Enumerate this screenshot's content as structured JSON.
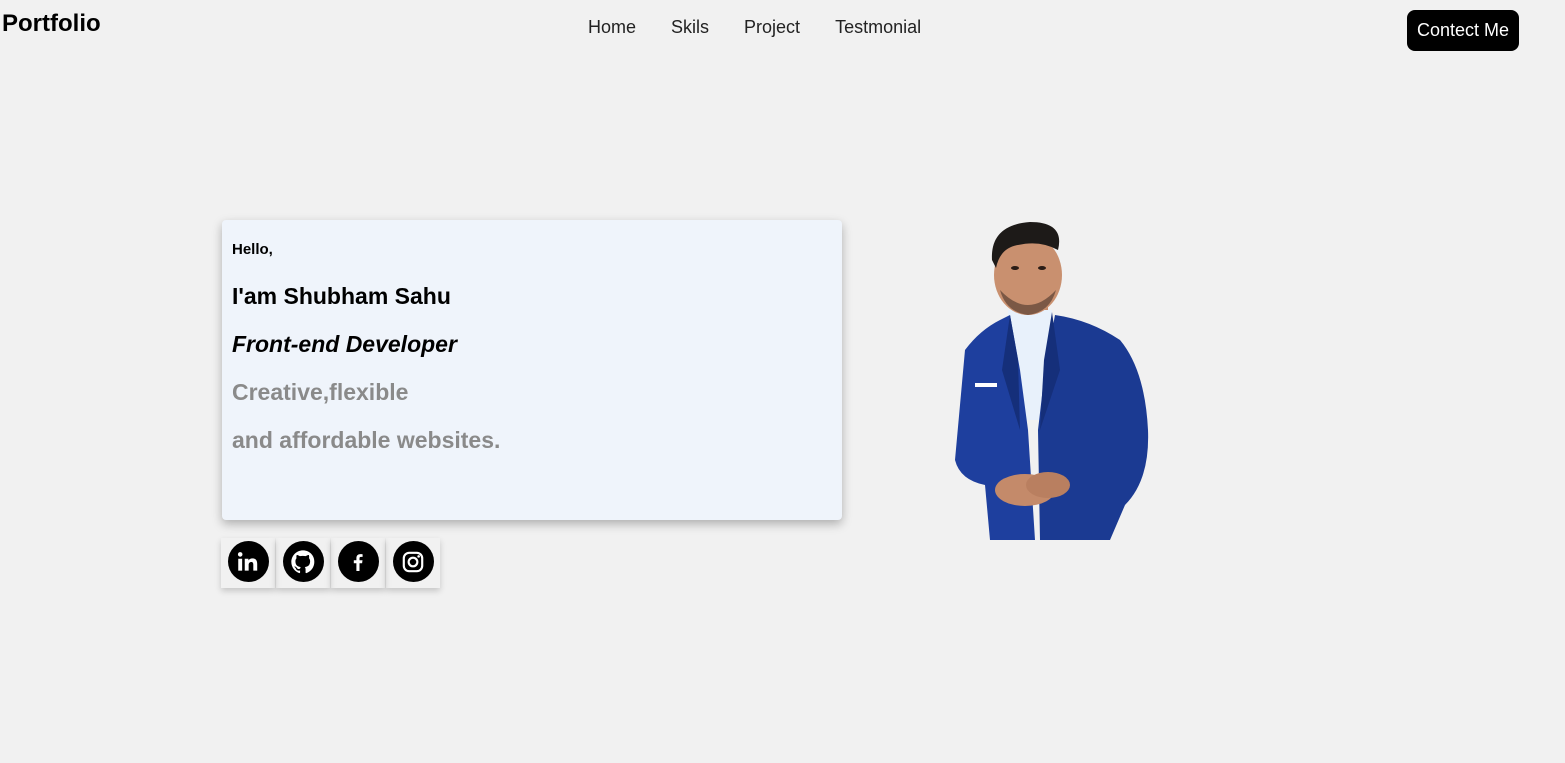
{
  "header": {
    "brand": "Portfolio",
    "nav": [
      "Home",
      "Skils",
      "Project",
      "Testmonial"
    ],
    "contact_label": "Contect Me"
  },
  "hero": {
    "greeting": "Hello,",
    "name": "I'am Shubham Sahu",
    "role": "Front-end Developer",
    "tagline_1": "Creative,flexible",
    "tagline_2": "and affordable websites."
  },
  "socials": [
    "linkedin-icon",
    "github-icon",
    "facebook-icon",
    "instagram-icon"
  ],
  "colors": {
    "background": "#f1f1f1",
    "card": "#eff4fb",
    "accent": "#000000",
    "muted_text": "#8a8a8a",
    "suit_blue": "#1e3f9e"
  }
}
